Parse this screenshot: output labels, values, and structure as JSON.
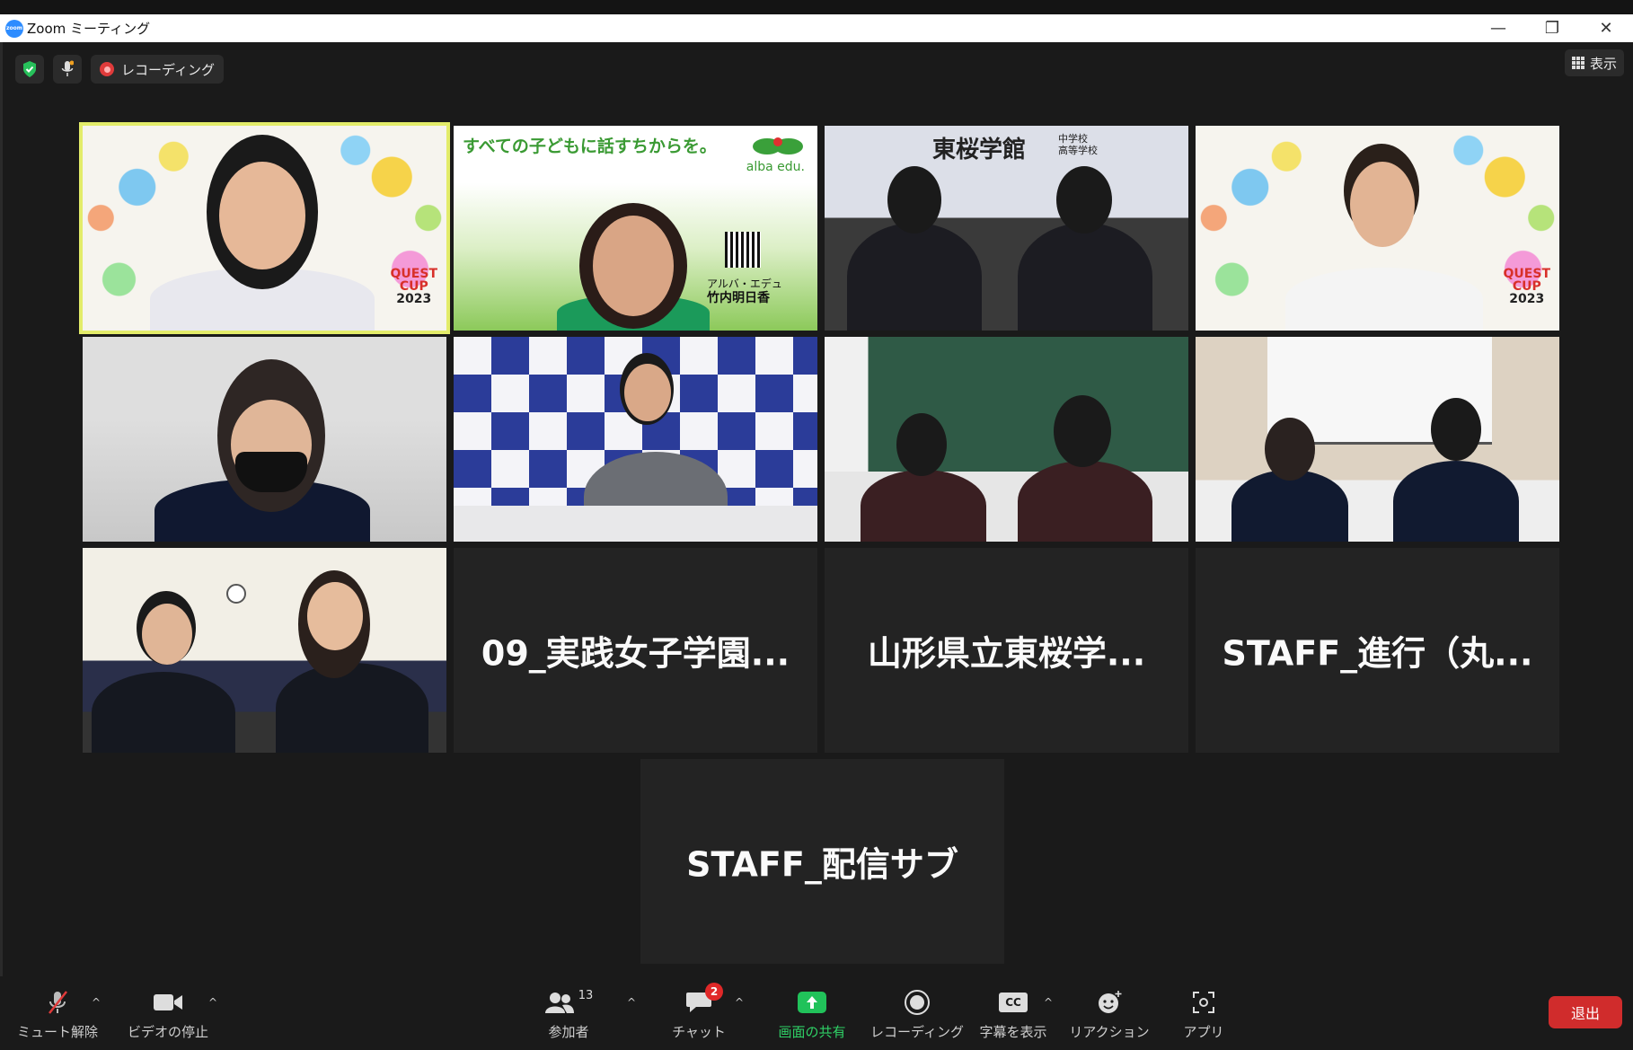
{
  "window": {
    "title": "Zoom ミーティング",
    "logo_text": "zoom",
    "minimize": "—",
    "restore": "❐",
    "close": "✕"
  },
  "top_bar": {
    "recording_label": "レコーディング",
    "view_label": "表示"
  },
  "tiles": [
    {
      "id": "p1",
      "badge": {
        "line1": "QUEST",
        "line2": "CUP",
        "year": "2023"
      }
    },
    {
      "id": "p2",
      "banner": "すべての子どもに話すちからを。",
      "brand": "alba edu.",
      "caption_line1": "アルバ・エデュ",
      "caption_line2": "竹内明日香"
    },
    {
      "id": "p3",
      "school_sign": "東桜学館",
      "school_sub1": "中学校",
      "school_sub2": "高等学校"
    },
    {
      "id": "p4",
      "badge": {
        "line1": "QUEST",
        "line2": "CUP",
        "year": "2023"
      }
    },
    {
      "id": "p5"
    },
    {
      "id": "p6"
    },
    {
      "id": "p7"
    },
    {
      "id": "p8"
    },
    {
      "id": "p9"
    },
    {
      "id": "p10",
      "name": "09_実践女子学園..."
    },
    {
      "id": "p11",
      "name": "山形県立東桜学..."
    },
    {
      "id": "p12",
      "name": "STAFF_進行（丸..."
    },
    {
      "id": "p13",
      "name": "STAFF_配信サブ"
    }
  ],
  "toolbar": {
    "mute_label": "ミュート解除",
    "video_label": "ビデオの停止",
    "participants_label": "参加者",
    "participants_count": "13",
    "chat_label": "チャット",
    "chat_badge": "2",
    "share_label": "画面の共有",
    "record_label": "レコーディング",
    "captions_label": "字幕を表示",
    "captions_icon_text": "CC",
    "reactions_label": "リアクション",
    "apps_label": "アプリ",
    "leave_label": "退出",
    "caret": "^"
  },
  "colors": {
    "active_speaker": "#e3ec6a",
    "share_green": "#21c25a",
    "leave_red": "#d02c2c",
    "badge_red": "#e02828"
  }
}
